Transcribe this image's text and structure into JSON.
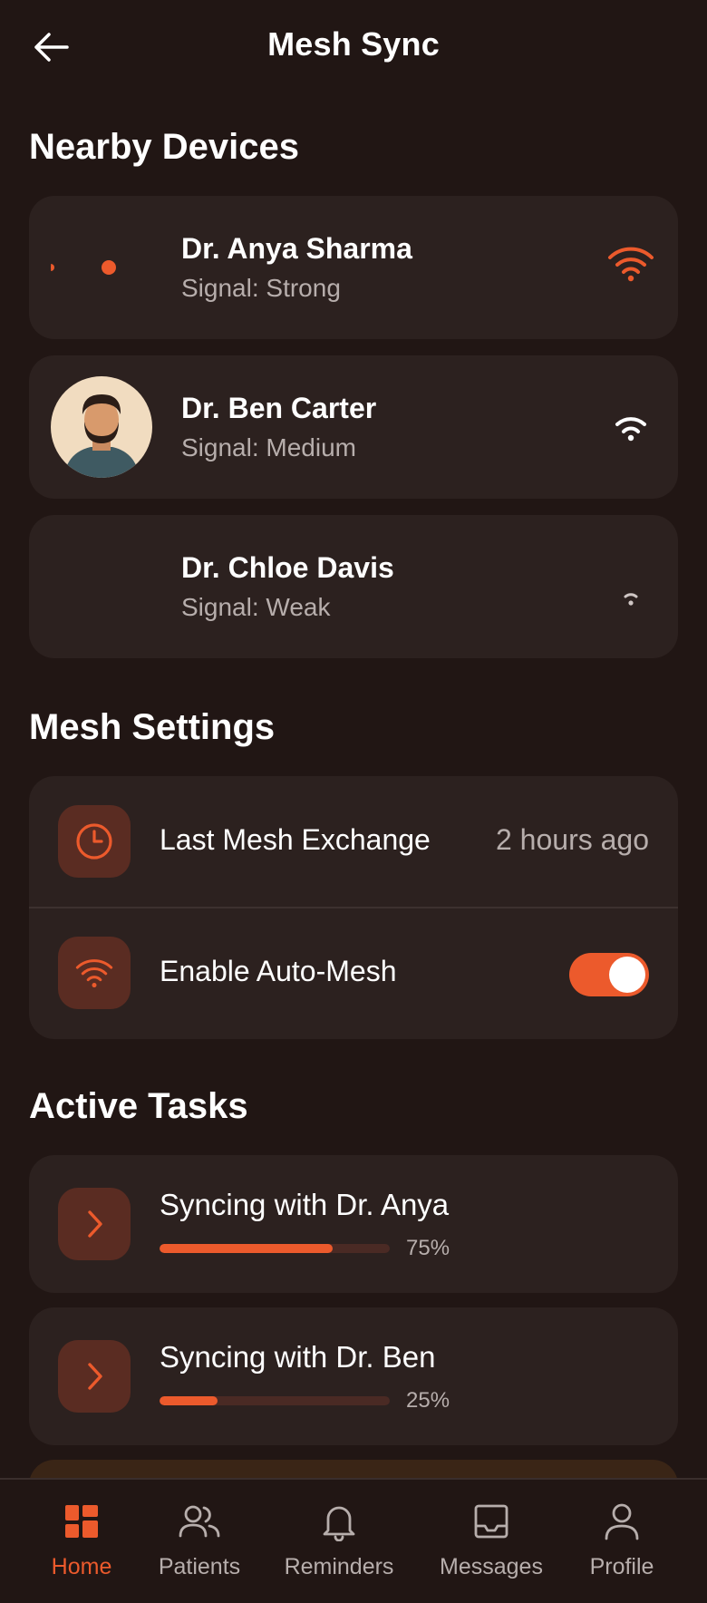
{
  "header": {
    "title": "Mesh Sync"
  },
  "nearby": {
    "title": "Nearby Devices",
    "devices": [
      {
        "name": "Dr. Anya Sharma",
        "signal": "Signal: Strong"
      },
      {
        "name": "Dr. Ben Carter",
        "signal": "Signal: Medium"
      },
      {
        "name": "Dr. Chloe Davis",
        "signal": "Signal: Weak"
      }
    ]
  },
  "settings": {
    "title": "Mesh Settings",
    "last_exchange_label": "Last Mesh Exchange",
    "last_exchange_value": "2 hours ago",
    "auto_mesh_label": "Enable Auto-Mesh",
    "auto_mesh_enabled": true
  },
  "tasks": {
    "title": "Active Tasks",
    "items": [
      {
        "label": "Syncing with Dr. Anya",
        "progress": 75,
        "progress_text": "75%"
      },
      {
        "label": "Syncing with Dr. Ben",
        "progress": 25,
        "progress_text": "25%"
      }
    ]
  },
  "nav": {
    "items": [
      {
        "label": "Home",
        "icon": "dashboard-icon",
        "active": true
      },
      {
        "label": "Patients",
        "icon": "people-icon"
      },
      {
        "label": "Reminders",
        "icon": "bell-icon"
      },
      {
        "label": "Messages",
        "icon": "inbox-icon"
      },
      {
        "label": "Profile",
        "icon": "user-icon"
      }
    ]
  },
  "colors": {
    "accent": "#ec5a2c",
    "background": "#211614",
    "card": "#2c211f",
    "muted": "#b7aeac"
  }
}
